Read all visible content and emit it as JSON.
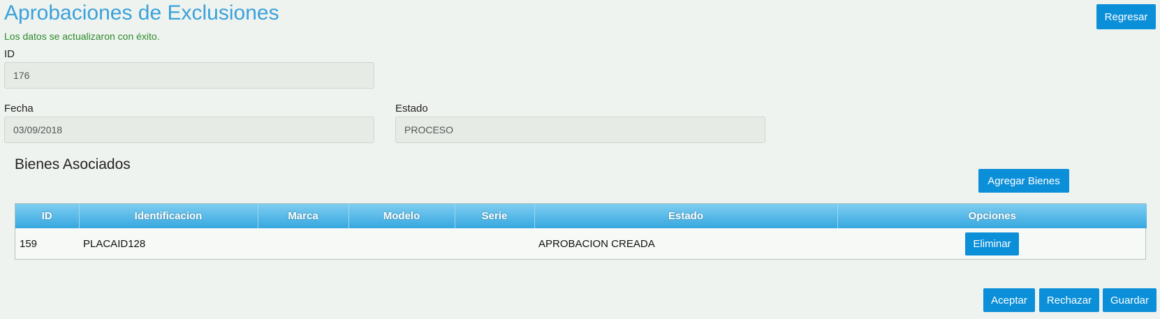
{
  "header": {
    "title": "Aprobaciones de Exclusiones",
    "back_button": "Regresar",
    "success_message": "Los datos se actualizaron con éxito."
  },
  "form": {
    "id": {
      "label": "ID",
      "value": "176"
    },
    "fecha": {
      "label": "Fecha",
      "value": "03/09/2018"
    },
    "estado": {
      "label": "Estado",
      "value": "PROCESO"
    }
  },
  "bienes": {
    "title": "Bienes Asociados",
    "add_button": "Agregar Bienes",
    "columns": [
      "ID",
      "Identificacion",
      "Marca",
      "Modelo",
      "Serie",
      "Estado",
      "Opciones"
    ],
    "rows": [
      {
        "id": "159",
        "identificacion": "PLACAID128",
        "marca": "",
        "modelo": "",
        "serie": "",
        "estado": "APROBACION CREADA",
        "action": "Eliminar"
      }
    ]
  },
  "footer": {
    "accept": "Aceptar",
    "reject": "Rechazar",
    "save": "Guardar"
  }
}
